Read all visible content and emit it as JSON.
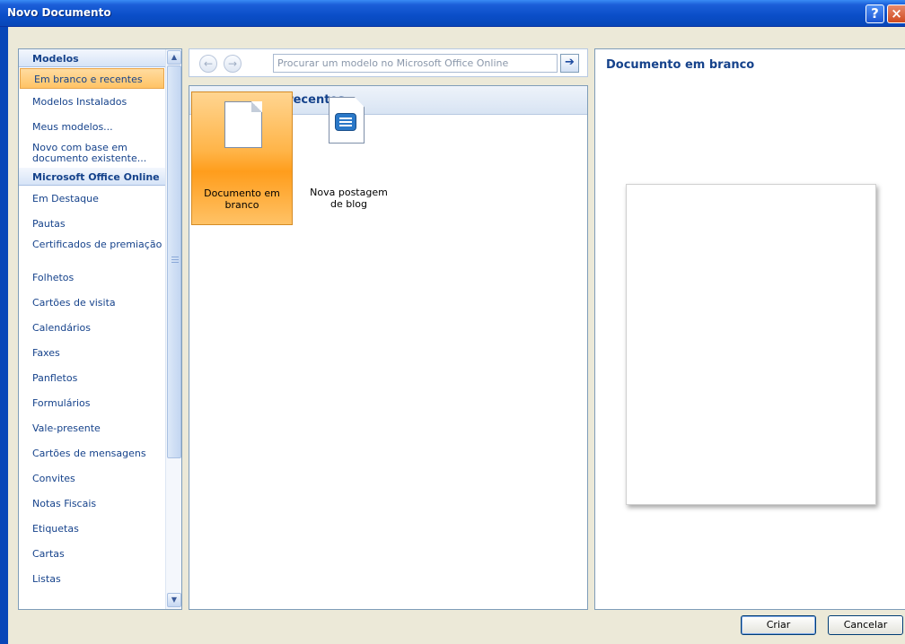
{
  "window": {
    "title": "Novo Documento",
    "help_glyph": "?",
    "close_glyph": "×"
  },
  "sidebar": {
    "items": [
      {
        "label": "Modelos",
        "kind": "header"
      },
      {
        "label": "Em branco e recentes",
        "kind": "item",
        "selected": true
      },
      {
        "label": "Modelos Instalados",
        "kind": "item"
      },
      {
        "label": "Meus modelos...",
        "kind": "item"
      },
      {
        "label": "Novo com base em documento existente...",
        "kind": "item"
      },
      {
        "label": "Microsoft Office Online",
        "kind": "header"
      },
      {
        "label": "Em Destaque",
        "kind": "item"
      },
      {
        "label": "Pautas",
        "kind": "item"
      },
      {
        "label": "Certificados de premiação",
        "kind": "item"
      },
      {
        "label": "Folhetos",
        "kind": "item"
      },
      {
        "label": "Cartões de visita",
        "kind": "item"
      },
      {
        "label": "Calendários",
        "kind": "item"
      },
      {
        "label": "Faxes",
        "kind": "item"
      },
      {
        "label": "Panfletos",
        "kind": "item"
      },
      {
        "label": "Formulários",
        "kind": "item"
      },
      {
        "label": "Vale-presente",
        "kind": "item"
      },
      {
        "label": "Cartões de mensagens",
        "kind": "item"
      },
      {
        "label": "Convites",
        "kind": "item"
      },
      {
        "label": "Notas Fiscais",
        "kind": "item"
      },
      {
        "label": "Etiquetas",
        "kind": "item"
      },
      {
        "label": "Cartas",
        "kind": "item"
      },
      {
        "label": "Listas",
        "kind": "item"
      }
    ]
  },
  "toolbar": {
    "back_glyph": "←",
    "forward_glyph": "→",
    "search_placeholder": "Procurar um modelo no Microsoft Office Online",
    "go_glyph": "➔"
  },
  "center": {
    "header": "Em branco e recentes",
    "templates": [
      {
        "line1": "Documento em",
        "line2": "branco",
        "selected": true
      },
      {
        "line1": "Nova postagem",
        "line2": "de blog",
        "selected": false
      }
    ]
  },
  "preview": {
    "title": "Documento em branco"
  },
  "buttons": {
    "create": "Criar",
    "cancel": "Cancelar"
  },
  "colors": {
    "title_bar": "#0a4ec8",
    "selection": "#ffc365",
    "link_text": "#15428b"
  }
}
